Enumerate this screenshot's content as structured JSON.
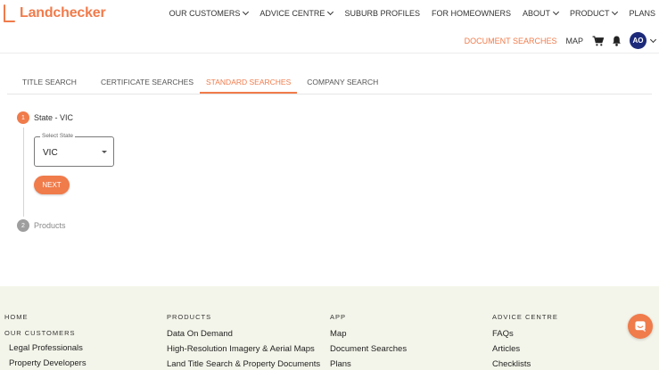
{
  "brand": {
    "name": "Landchecker",
    "accent": "#f07b4b"
  },
  "topnav": [
    {
      "label": "OUR CUSTOMERS",
      "dropdown": true
    },
    {
      "label": "ADVICE CENTRE",
      "dropdown": true
    },
    {
      "label": "SUBURB PROFILES",
      "dropdown": false
    },
    {
      "label": "FOR HOMEOWNERS",
      "dropdown": false
    },
    {
      "label": "ABOUT",
      "dropdown": true
    },
    {
      "label": "PRODUCT",
      "dropdown": true
    },
    {
      "label": "PLANS",
      "dropdown": false
    }
  ],
  "subnav": {
    "document_searches": "DOCUMENT SEARCHES",
    "map": "MAP",
    "cart_icon": "cart-icon",
    "bell_icon": "bell-icon",
    "avatar_initials": "AO"
  },
  "tabs": [
    {
      "label": "TITLE SEARCH",
      "active": false
    },
    {
      "label": "CERTIFICATE SEARCHES",
      "active": false
    },
    {
      "label": "STANDARD SEARCHES",
      "active": true
    },
    {
      "label": "COMPANY SEARCH",
      "active": false
    }
  ],
  "stepper": {
    "step1": {
      "number": "1",
      "label": "State - VIC"
    },
    "select": {
      "legend": "Select State",
      "value": "VIC"
    },
    "next_label": "NEXT",
    "step2": {
      "number": "2",
      "label": "Products"
    }
  },
  "footer": {
    "col1": {
      "heading": "HOME",
      "subheading": "OUR CUSTOMERS",
      "links": [
        "Legal Professionals",
        "Property Developers"
      ]
    },
    "col2": {
      "heading": "PRODUCTS",
      "links": [
        "Data On Demand",
        "High-Resolution Imagery & Aerial Maps",
        "Land Title Search & Property Documents"
      ]
    },
    "col3": {
      "heading": "APP",
      "links": [
        "Map",
        "Document Searches",
        "Plans"
      ]
    },
    "col4": {
      "heading": "ADVICE CENTRE",
      "links": [
        "FAQs",
        "Articles",
        "Checklists"
      ]
    }
  },
  "chat_icon": "chat-icon"
}
